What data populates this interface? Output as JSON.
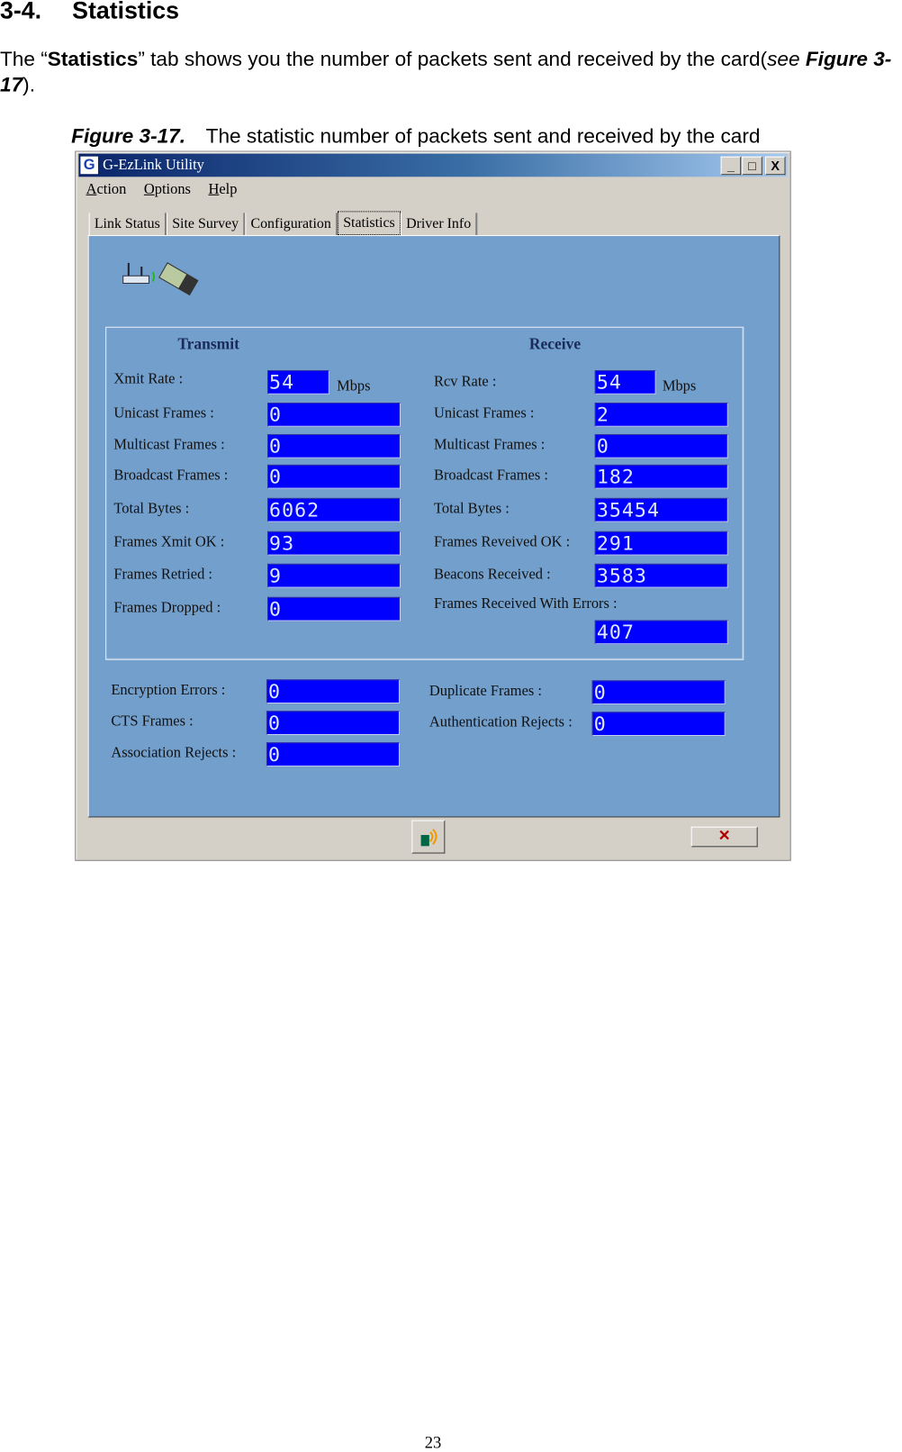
{
  "section": {
    "number": "3-4.",
    "title": "Statistics"
  },
  "intro": {
    "text_before": "The “",
    "bold": "Statistics",
    "text_after": "” tab shows you the number of packets sent and received by the card(",
    "italic_see": "see",
    "figure_ref": "Figure 3-17",
    "closing": ")."
  },
  "figure": {
    "label": "Figure 3-17.",
    "caption": "The statistic number of packets sent and received by the card"
  },
  "window": {
    "title": "G-EzLink Utility",
    "app_icon_letter": "G",
    "controls": {
      "minimize": "_",
      "maximize": "□",
      "close": "X"
    },
    "menu": [
      "Action",
      "Options",
      "Help"
    ],
    "tabs": [
      "Link Status",
      "Site Survey",
      "Configuration",
      "Statistics",
      "Driver Info"
    ],
    "active_tab": "Statistics",
    "transmit": {
      "title": "Transmit",
      "rate_label": "Xmit Rate :",
      "rate": "54",
      "rate_unit": "Mbps",
      "rows": [
        {
          "label": "Unicast Frames :",
          "value": "0"
        },
        {
          "label": "Multicast Frames :",
          "value": "0"
        },
        {
          "label": "Broadcast Frames :",
          "value": "0"
        },
        {
          "label": "Total Bytes :",
          "value": "6062"
        },
        {
          "label": "Frames Xmit OK :",
          "value": "93"
        },
        {
          "label": "Frames Retried :",
          "value": "9"
        },
        {
          "label": "Frames Dropped :",
          "value": "0"
        }
      ]
    },
    "receive": {
      "title": "Receive",
      "rate_label": "Rcv Rate :",
      "rate": "54",
      "rate_unit": "Mbps",
      "rows": [
        {
          "label": "Unicast Frames :",
          "value": "2"
        },
        {
          "label": "Multicast Frames :",
          "value": "0"
        },
        {
          "label": "Broadcast Frames :",
          "value": "182"
        },
        {
          "label": "Total Bytes :",
          "value": "35454"
        },
        {
          "label": "Frames Reveived OK :",
          "value": "291"
        },
        {
          "label": "Beacons Received :",
          "value": "3583"
        },
        {
          "label": "Frames Received With Errors :",
          "value": "407"
        }
      ]
    },
    "other": {
      "left": [
        {
          "label": "Encryption Errors :",
          "value": "0"
        },
        {
          "label": "CTS Frames :",
          "value": "0"
        },
        {
          "label": "Association Rejects :",
          "value": "0"
        }
      ],
      "right": [
        {
          "label": "Duplicate Frames :",
          "value": "0"
        },
        {
          "label": "Authentication Rejects :",
          "value": "0"
        }
      ]
    },
    "buttons": {
      "close_glyph": "✕"
    }
  },
  "page_number": "23"
}
